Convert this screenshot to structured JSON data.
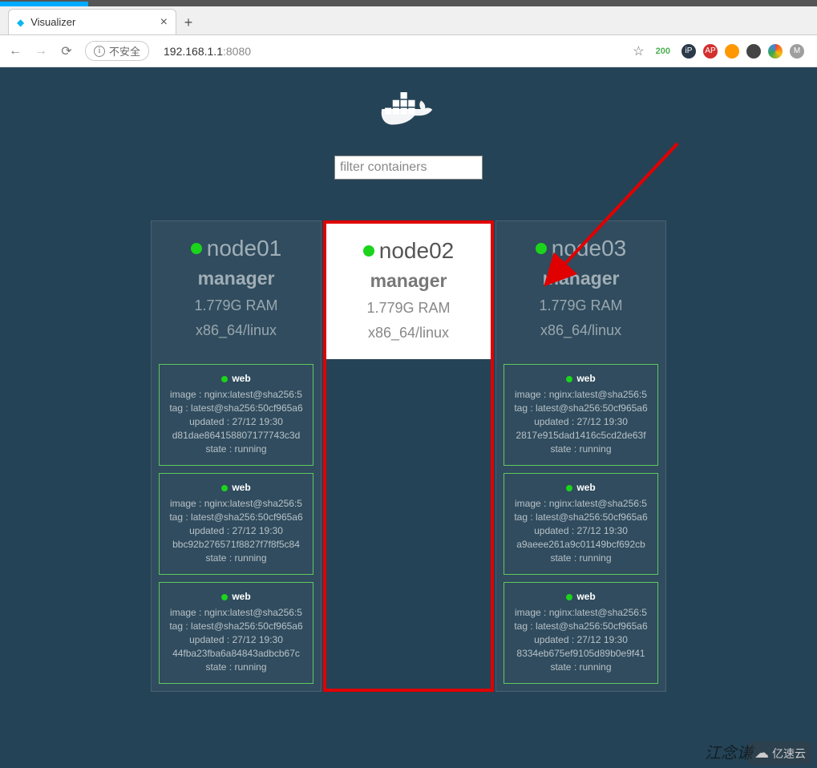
{
  "browser": {
    "tab_title": "Visualizer",
    "insecure_label": "不安全",
    "url_host": "192.168.1.1",
    "url_port": ":8080",
    "badge": "200"
  },
  "filter": {
    "placeholder": "filter containers"
  },
  "nodes": [
    {
      "name": "node01",
      "role": "manager",
      "ram": "1.779G RAM",
      "arch": "x86_64/linux",
      "highlight": false,
      "services": [
        {
          "name": "web",
          "image": "image : nginx:latest@sha256:5",
          "tag": "tag : latest@sha256:50cf965a6",
          "updated": "updated : 27/12 19:30",
          "id": "d81dae864158807177743c3d",
          "state": "state : running"
        },
        {
          "name": "web",
          "image": "image : nginx:latest@sha256:5",
          "tag": "tag : latest@sha256:50cf965a6",
          "updated": "updated : 27/12 19:30",
          "id": "bbc92b276571f8827f7f8f5c84",
          "state": "state : running"
        },
        {
          "name": "web",
          "image": "image : nginx:latest@sha256:5",
          "tag": "tag : latest@sha256:50cf965a6",
          "updated": "updated : 27/12 19:30",
          "id": "44fba23fba6a84843adbcb67c",
          "state": "state : running"
        }
      ]
    },
    {
      "name": "node02",
      "role": "manager",
      "ram": "1.779G RAM",
      "arch": "x86_64/linux",
      "highlight": true,
      "services": []
    },
    {
      "name": "node03",
      "role": "manager",
      "ram": "1.779G RAM",
      "arch": "x86_64/linux",
      "highlight": false,
      "services": [
        {
          "name": "web",
          "image": "image : nginx:latest@sha256:5",
          "tag": "tag : latest@sha256:50cf965a6",
          "updated": "updated : 27/12 19:30",
          "id": "2817e915dad1416c5cd2de63f",
          "state": "state : running"
        },
        {
          "name": "web",
          "image": "image : nginx:latest@sha256:5",
          "tag": "tag : latest@sha256:50cf965a6",
          "updated": "updated : 27/12 19:30",
          "id": "a9aeee261a9c01149bcf692cb",
          "state": "state : running"
        },
        {
          "name": "web",
          "image": "image : nginx:latest@sha256:5",
          "tag": "tag : latest@sha256:50cf965a6",
          "updated": "updated : 27/12 19:30",
          "id": "8334eb675ef9105d89b0e9f41",
          "state": "state : running"
        }
      ]
    }
  ],
  "watermark": {
    "text": "江念谦",
    "brand": "亿速云"
  }
}
